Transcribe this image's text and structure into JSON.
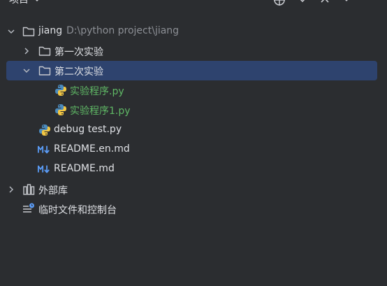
{
  "header": {
    "title": "项目"
  },
  "tree": {
    "root": {
      "name": "jiang",
      "path": "D:\\python project\\jiang"
    },
    "folder1": {
      "name": "第一次实验"
    },
    "folder2": {
      "name": "第二次实验"
    },
    "file1": {
      "name": "实验程序.py"
    },
    "file2": {
      "name": "实验程序1.py"
    },
    "file3": {
      "name": "debug test.py"
    },
    "file4": {
      "name": "README.en.md"
    },
    "file5": {
      "name": "README.md"
    },
    "external": {
      "name": "外部库"
    },
    "scratches": {
      "name": "临时文件和控制台"
    }
  },
  "colors": {
    "background": "#2b2d30",
    "selection": "#2e436e",
    "text": "#dfe1e5",
    "path_text": "#8c8f95",
    "modified_green": "#5fb865",
    "python_blue": "#4b8bbe",
    "python_yellow": "#f2c744",
    "markdown_blue": "#5a9bf5"
  }
}
